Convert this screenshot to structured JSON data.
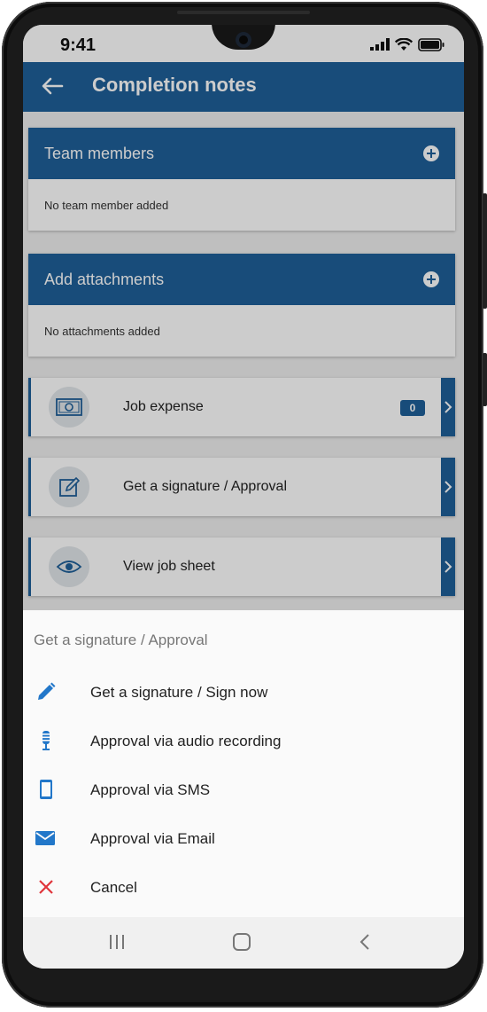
{
  "status": {
    "time": "9:41"
  },
  "appbar": {
    "title": "Completion notes"
  },
  "team_members": {
    "header": "Team members",
    "empty_text": "No team member added"
  },
  "attachments": {
    "header": "Add attachments",
    "empty_text": "No attachments added"
  },
  "actions": {
    "job_expense": {
      "label": "Job expense",
      "count": "0",
      "icon": "money-icon"
    },
    "signature": {
      "label": "Get a signature / Approval",
      "icon": "edit-icon"
    },
    "job_sheet": {
      "label": "View job sheet",
      "icon": "eye-icon"
    }
  },
  "sheet": {
    "title": "Get a signature / Approval",
    "options": [
      {
        "label": "Get a signature / Sign now",
        "icon": "pencil-icon"
      },
      {
        "label": "Approval via audio recording",
        "icon": "microphone-icon"
      },
      {
        "label": "Approval via SMS",
        "icon": "phone-icon"
      },
      {
        "label": "Approval via Email",
        "icon": "mail-icon"
      },
      {
        "label": "Cancel",
        "icon": "close-icon"
      }
    ]
  },
  "colors": {
    "primary": "#1e5f99",
    "cancel": "#e0343a",
    "icon_blue": "#2277c9"
  }
}
